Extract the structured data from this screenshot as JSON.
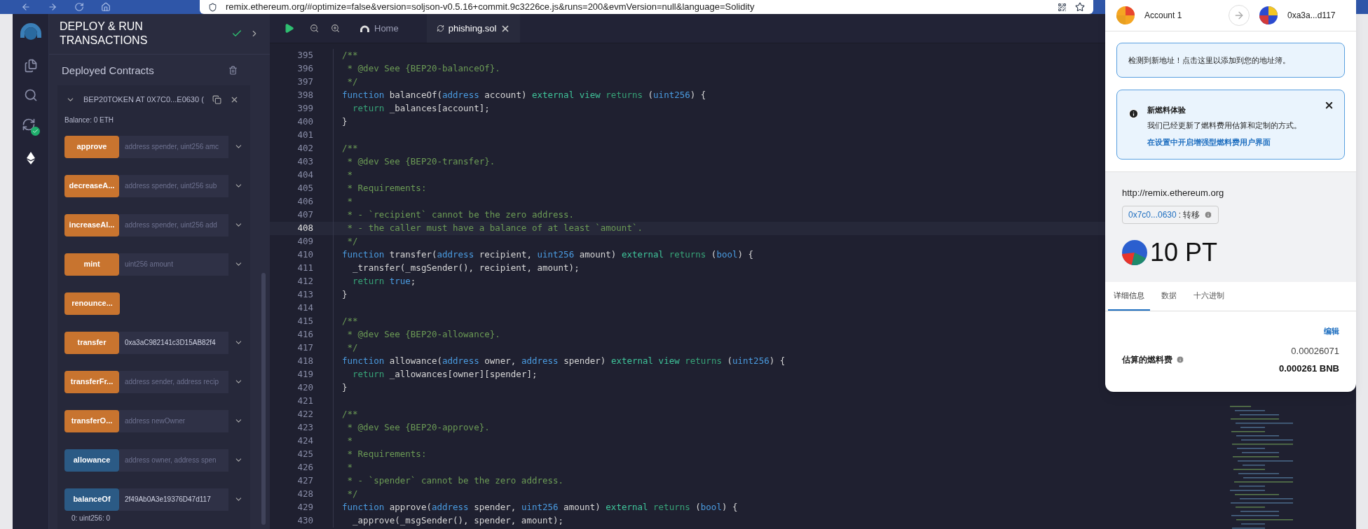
{
  "browser": {
    "url": "remix.ethereum.org/#optimize=false&version=soljson-v0.5.16+commit.9c3226ce.js&runs=200&evmVersion=null&language=Solidity"
  },
  "side_panel": {
    "title": "DEPLOY & RUN TRANSACTIONS",
    "section": "Deployed Contracts",
    "contract": {
      "name": "BEP20TOKEN AT 0X7C0...E0630 (",
      "expanded": true,
      "balance": "Balance: 0 ETH",
      "functions": [
        {
          "name": "approve",
          "kind": "transact",
          "placeholder": "address spender, uint256 amc"
        },
        {
          "name": "decreaseA...",
          "kind": "transact",
          "placeholder": "address spender, uint256 sub"
        },
        {
          "name": "increaseAl...",
          "kind": "transact",
          "placeholder": "address spender, uint256 add"
        },
        {
          "name": "mint",
          "kind": "transact",
          "placeholder": "uint256 amount"
        },
        {
          "name": "renounce...",
          "kind": "transact"
        },
        {
          "name": "transfer",
          "kind": "transact",
          "value": "0xa3aC982141c3D15AB82f4"
        },
        {
          "name": "transferFr...",
          "kind": "transact",
          "placeholder": "address sender, address recip"
        },
        {
          "name": "transferO...",
          "kind": "transact",
          "placeholder": "address newOwner"
        },
        {
          "name": "allowance",
          "kind": "call",
          "placeholder": "address owner, address spen"
        },
        {
          "name": "balanceOf",
          "kind": "call",
          "value": "2f49Ab0A3e19376D47d117",
          "output": "0: uint256: 0"
        }
      ]
    }
  },
  "editor": {
    "tabs": [
      {
        "label": "Home",
        "kind": "home",
        "selected": false
      },
      {
        "label": "phishing.sol",
        "kind": "file",
        "selected": true
      }
    ],
    "lines": [
      {
        "number": "395",
        "highlighted": false,
        "tokens": [
          {
            "kind": "comment",
            "text": "/**"
          }
        ]
      },
      {
        "number": "396",
        "highlighted": false,
        "tokens": [
          {
            "kind": "comment",
            "text": " * @dev See {BEP20-balanceOf}."
          }
        ]
      },
      {
        "number": "397",
        "highlighted": false,
        "tokens": [
          {
            "kind": "comment",
            "text": " */"
          }
        ]
      },
      {
        "number": "398",
        "highlighted": false,
        "tokens": [
          {
            "kind": "keyword",
            "text": "function"
          },
          {
            "kind": "plain",
            "text": " balanceOf("
          },
          {
            "kind": "type",
            "text": "address"
          },
          {
            "kind": "plain",
            "text": " account) "
          },
          {
            "kind": "modifier",
            "text": "external "
          },
          {
            "kind": "modifier",
            "text": "view "
          },
          {
            "kind": "return",
            "text": "returns"
          },
          {
            "kind": "plain",
            "text": " ("
          },
          {
            "kind": "type",
            "text": "uint256"
          },
          {
            "kind": "plain",
            "text": ") {"
          }
        ]
      },
      {
        "number": "399",
        "highlighted": false,
        "tokens": [
          {
            "kind": "return",
            "text": "  return"
          },
          {
            "kind": "plain",
            "text": " _balances[account];"
          }
        ]
      },
      {
        "number": "400",
        "highlighted": false,
        "tokens": [
          {
            "kind": "plain",
            "text": "}"
          }
        ]
      },
      {
        "number": "401",
        "highlighted": false
      },
      {
        "number": "402",
        "highlighted": false,
        "tokens": [
          {
            "kind": "comment",
            "text": "/**"
          }
        ]
      },
      {
        "number": "403",
        "highlighted": false,
        "tokens": [
          {
            "kind": "comment",
            "text": " * @dev See {BEP20-transfer}."
          }
        ]
      },
      {
        "number": "404",
        "highlighted": false,
        "tokens": [
          {
            "kind": "comment",
            "text": " *"
          }
        ]
      },
      {
        "number": "405",
        "highlighted": false,
        "tokens": [
          {
            "kind": "comment",
            "text": " * Requirements:"
          }
        ]
      },
      {
        "number": "406",
        "highlighted": false,
        "tokens": [
          {
            "kind": "comment",
            "text": " *"
          }
        ]
      },
      {
        "number": "407",
        "highlighted": false,
        "tokens": [
          {
            "kind": "comment",
            "text": " * - `recipient` cannot be the zero address."
          }
        ]
      },
      {
        "number": "408",
        "highlighted": true,
        "tokens": [
          {
            "kind": "comment",
            "text": " * - the caller must have a balance of at least `amount`."
          }
        ]
      },
      {
        "number": "409",
        "highlighted": false,
        "tokens": [
          {
            "kind": "comment",
            "text": " */"
          }
        ]
      },
      {
        "number": "410",
        "highlighted": false,
        "tokens": [
          {
            "kind": "keyword",
            "text": "function"
          },
          {
            "kind": "plain",
            "text": " transfer("
          },
          {
            "kind": "type",
            "text": "address"
          },
          {
            "kind": "plain",
            "text": " recipient, "
          },
          {
            "kind": "type",
            "text": "uint256"
          },
          {
            "kind": "plain",
            "text": " amount) "
          },
          {
            "kind": "modifier",
            "text": "external "
          },
          {
            "kind": "return",
            "text": "returns"
          },
          {
            "kind": "plain",
            "text": " ("
          },
          {
            "kind": "type",
            "text": "bool"
          },
          {
            "kind": "plain",
            "text": ") {"
          }
        ]
      },
      {
        "number": "411",
        "highlighted": false,
        "tokens": [
          {
            "kind": "plain",
            "text": "  _transfer(_msgSender(), recipient, amount);"
          }
        ]
      },
      {
        "number": "412",
        "highlighted": false,
        "tokens": [
          {
            "kind": "return",
            "text": "  return "
          },
          {
            "kind": "type",
            "text": "true"
          },
          {
            "kind": "plain",
            "text": ";"
          }
        ]
      },
      {
        "number": "413",
        "highlighted": false,
        "tokens": [
          {
            "kind": "plain",
            "text": "}"
          }
        ]
      },
      {
        "number": "414",
        "highlighted": false
      },
      {
        "number": "415",
        "highlighted": false,
        "tokens": [
          {
            "kind": "comment",
            "text": "/**"
          }
        ]
      },
      {
        "number": "416",
        "highlighted": false,
        "tokens": [
          {
            "kind": "comment",
            "text": " * @dev See {BEP20-allowance}."
          }
        ]
      },
      {
        "number": "417",
        "highlighted": false,
        "tokens": [
          {
            "kind": "comment",
            "text": " */"
          }
        ]
      },
      {
        "number": "418",
        "highlighted": false,
        "tokens": [
          {
            "kind": "keyword",
            "text": "function"
          },
          {
            "kind": "plain",
            "text": " allowance("
          },
          {
            "kind": "type",
            "text": "address"
          },
          {
            "kind": "plain",
            "text": " owner, "
          },
          {
            "kind": "type",
            "text": "address"
          },
          {
            "kind": "plain",
            "text": " spender) "
          },
          {
            "kind": "modifier",
            "text": "external "
          },
          {
            "kind": "modifier",
            "text": "view "
          },
          {
            "kind": "return",
            "text": "returns"
          },
          {
            "kind": "plain",
            "text": " ("
          },
          {
            "kind": "type",
            "text": "uint256"
          },
          {
            "kind": "plain",
            "text": ") {"
          }
        ]
      },
      {
        "number": "419",
        "highlighted": false,
        "tokens": [
          {
            "kind": "return",
            "text": "  return"
          },
          {
            "kind": "plain",
            "text": " _allowances[owner][spender];"
          }
        ]
      },
      {
        "number": "420",
        "highlighted": false,
        "tokens": [
          {
            "kind": "plain",
            "text": "}"
          }
        ]
      },
      {
        "number": "421",
        "highlighted": false
      },
      {
        "number": "422",
        "highlighted": false,
        "tokens": [
          {
            "kind": "comment",
            "text": "/**"
          }
        ]
      },
      {
        "number": "423",
        "highlighted": false,
        "tokens": [
          {
            "kind": "comment",
            "text": " * @dev See {BEP20-approve}."
          }
        ]
      },
      {
        "number": "424",
        "highlighted": false,
        "tokens": [
          {
            "kind": "comment",
            "text": " *"
          }
        ]
      },
      {
        "number": "425",
        "highlighted": false,
        "tokens": [
          {
            "kind": "comment",
            "text": " * Requirements:"
          }
        ]
      },
      {
        "number": "426",
        "highlighted": false,
        "tokens": [
          {
            "kind": "comment",
            "text": " *"
          }
        ]
      },
      {
        "number": "427",
        "highlighted": false,
        "tokens": [
          {
            "kind": "comment",
            "text": " * - `spender` cannot be the zero address."
          }
        ]
      },
      {
        "number": "428",
        "highlighted": false,
        "tokens": [
          {
            "kind": "comment",
            "text": " */"
          }
        ]
      },
      {
        "number": "429",
        "highlighted": false,
        "tokens": [
          {
            "kind": "keyword",
            "text": "function"
          },
          {
            "kind": "plain",
            "text": " approve("
          },
          {
            "kind": "type",
            "text": "address"
          },
          {
            "kind": "plain",
            "text": " spender, "
          },
          {
            "kind": "type",
            "text": "uint256"
          },
          {
            "kind": "plain",
            "text": " amount) "
          },
          {
            "kind": "modifier",
            "text": "external "
          },
          {
            "kind": "return",
            "text": "returns"
          },
          {
            "kind": "plain",
            "text": " ("
          },
          {
            "kind": "type",
            "text": "bool"
          },
          {
            "kind": "plain",
            "text": ") {"
          }
        ]
      },
      {
        "number": "430",
        "highlighted": false,
        "tokens": [
          {
            "kind": "plain",
            "text": "  _approve(_msgSender(), spender, amount);"
          }
        ]
      }
    ]
  },
  "wallet": {
    "from": "Account 1",
    "to": "0xa3a...d117",
    "notice": "检测到新地址！点击这里以添加到您的地址簿。",
    "alert": {
      "title": "新燃料体验",
      "body": "我们已经更新了燃料费用估算和定制的方式。",
      "link": "在设置中开启增强型燃料费用户界面"
    },
    "origin": "http://remix.ethereum.org",
    "contract_address": "0x7c0...0630",
    "method": ": 转移",
    "amount": "10 PT",
    "tabs": [
      {
        "label": "详细信息",
        "selected": true
      },
      {
        "label": "数据",
        "selected": false
      },
      {
        "label": "十六进制",
        "selected": false
      }
    ],
    "edit": "编辑",
    "fee_label": "估算的燃料费",
    "fee_value": "0.00026071",
    "fee_total": "0.000261 BNB"
  }
}
